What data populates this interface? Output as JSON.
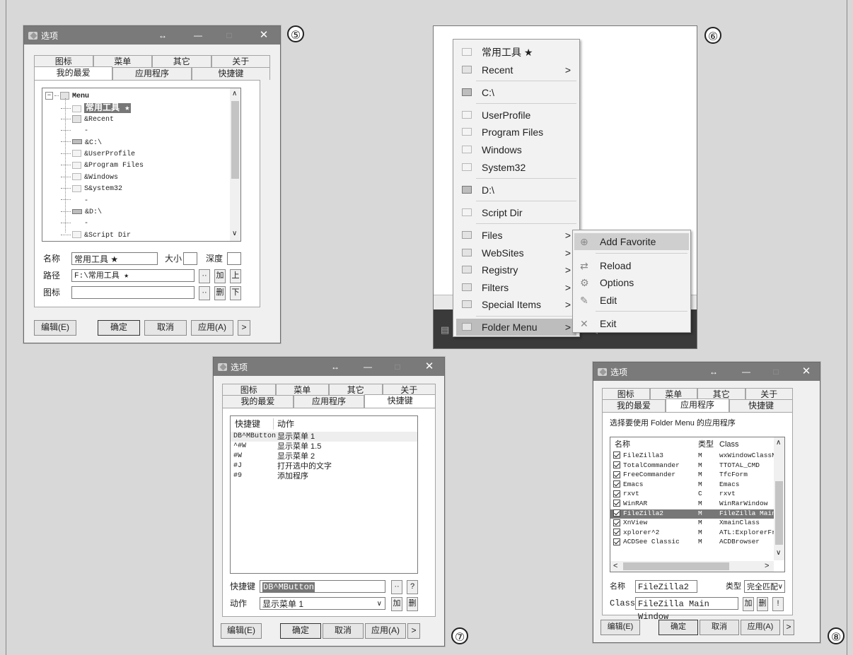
{
  "markers": {
    "w5": "⑤",
    "w6": "⑥",
    "w7": "⑦",
    "w8": "⑧"
  },
  "title": "选项",
  "titlebar_controls": {
    "resize": "↔",
    "minimize": "—",
    "maximize": "□",
    "close": "✕"
  },
  "tabs_top": [
    "图标",
    "菜单",
    "其它",
    "关于"
  ],
  "tabs_bottom": [
    "我的最爱",
    "应用程序",
    "快捷键"
  ],
  "w5": {
    "tree": [
      {
        "label": "Menu",
        "icon": "menu-icon"
      },
      {
        "label": "常用工具 ★",
        "icon": "folder-icon"
      },
      {
        "label": "&Recent",
        "icon": "recent-icon"
      },
      {
        "label": "-",
        "icon": ""
      },
      {
        "label": "&C:\\",
        "icon": "drive-icon"
      },
      {
        "label": "&UserProfile",
        "icon": "folder-icon"
      },
      {
        "label": "&Program Files",
        "icon": "folder-icon"
      },
      {
        "label": "&Windows",
        "icon": "folder-icon"
      },
      {
        "label": "S&ystem32",
        "icon": "folder-icon"
      },
      {
        "label": "-",
        "icon": ""
      },
      {
        "label": "&D:\\",
        "icon": "drive-icon"
      },
      {
        "label": "-",
        "icon": ""
      },
      {
        "label": "&Script Dir",
        "icon": "folder-icon"
      }
    ],
    "name_label": "名称",
    "name_value": "常用工具 ★",
    "size_label": "大小",
    "depth_label": "深度",
    "path_label": "路径",
    "path_value": "F:\\常用工具 ★",
    "icon_label": "图标",
    "dots": "··",
    "add": "加",
    "up": "上",
    "del": "删",
    "down": "下",
    "edit": "编辑(E)",
    "ok": "确定",
    "cancel": "取消",
    "apply": "应用(A)",
    "more": ">"
  },
  "w6": {
    "main_menu": [
      {
        "label": "常用工具 ★",
        "icon": "folder-icon",
        "arrow": ""
      },
      {
        "label": "Recent",
        "icon": "recent-icon",
        "arrow": ">"
      },
      {
        "label": "C:\\",
        "icon": "drive-icon",
        "arrow": ""
      },
      {
        "label": "UserProfile",
        "icon": "folder-icon",
        "arrow": ""
      },
      {
        "label": "Program Files",
        "icon": "folder-icon",
        "arrow": ""
      },
      {
        "label": "Windows",
        "icon": "folder-icon",
        "arrow": ""
      },
      {
        "label": "System32",
        "icon": "folder-icon",
        "arrow": ""
      },
      {
        "label": "D:\\",
        "icon": "drive-icon",
        "arrow": ""
      },
      {
        "label": "Script Dir",
        "icon": "folder-icon",
        "arrow": ""
      },
      {
        "label": "Files",
        "icon": "files-icon",
        "arrow": ">"
      },
      {
        "label": "WebSites",
        "icon": "ie-icon",
        "arrow": ">"
      },
      {
        "label": "Registry",
        "icon": "registry-icon",
        "arrow": ">"
      },
      {
        "label": "Filters",
        "icon": "filter-icon",
        "arrow": ">"
      },
      {
        "label": "Special Items",
        "icon": "special-icon",
        "arrow": ">"
      },
      {
        "label": "Folder Menu",
        "icon": "foldermenu-icon",
        "arrow": ">"
      }
    ],
    "sub_menu": [
      {
        "label": "Add Favorite",
        "icon": "add-icon"
      },
      {
        "label": "Reload",
        "icon": "reload-icon"
      },
      {
        "label": "Options",
        "icon": "gear-icon"
      },
      {
        "label": "Edit",
        "icon": "edit-icon"
      },
      {
        "label": "Exit",
        "icon": "close-icon"
      }
    ]
  },
  "w7": {
    "col_key": "快捷键",
    "col_action": "动作",
    "rows": [
      {
        "key": "DB^MButton",
        "action": "显示菜单 1"
      },
      {
        "key": "^#W",
        "action": "显示菜单 1.5"
      },
      {
        "key": "#W",
        "action": "显示菜单 2"
      },
      {
        "key": "#J",
        "action": "打开选中的文字"
      },
      {
        "key": "#9",
        "action": "添加程序"
      }
    ],
    "key_label": "快捷键",
    "key_value": "DB^MButton",
    "action_label": "动作",
    "action_value": "显示菜单 1",
    "dots": "··",
    "help": "?",
    "add": "加",
    "del": "删",
    "edit": "编辑(E)",
    "ok": "确定",
    "cancel": "取消",
    "apply": "应用(A)",
    "more": ">"
  },
  "w8": {
    "heading": "选择要使用 Folder Menu 的应用程序",
    "col_name": "名称",
    "col_type": "类型",
    "col_class": "Class",
    "rows": [
      {
        "name": "FileZilla3",
        "type": "M",
        "cls": "wxWindowClassN"
      },
      {
        "name": "TotalCommander",
        "type": "M",
        "cls": "TTOTAL_CMD"
      },
      {
        "name": "FreeCommander",
        "type": "M",
        "cls": "TfcForm"
      },
      {
        "name": "Emacs",
        "type": "M",
        "cls": "Emacs"
      },
      {
        "name": "rxvt",
        "type": "C",
        "cls": "rxvt"
      },
      {
        "name": "WinRAR",
        "type": "M",
        "cls": "WinRarWindow"
      },
      {
        "name": "FileZilla2",
        "type": "M",
        "cls": "FileZilla Main"
      },
      {
        "name": "XnView",
        "type": "M",
        "cls": "XmainClass"
      },
      {
        "name": "xplorer^2",
        "type": "M",
        "cls": "ATL:ExplorerFr"
      },
      {
        "name": "ACDSee Classic",
        "type": "M",
        "cls": "ACDBrowser"
      }
    ],
    "selected_index": 6,
    "name_label": "名称",
    "name_value": "FileZilla2",
    "type_label": "类型",
    "type_value": "完全匹配",
    "class_label": "Class",
    "class_value": "FileZilla Main Window",
    "add": "加",
    "del": "删",
    "bang": "!",
    "edit": "编辑(E)",
    "ok": "确定",
    "cancel": "取消",
    "apply": "应用(A)",
    "more": ">"
  }
}
